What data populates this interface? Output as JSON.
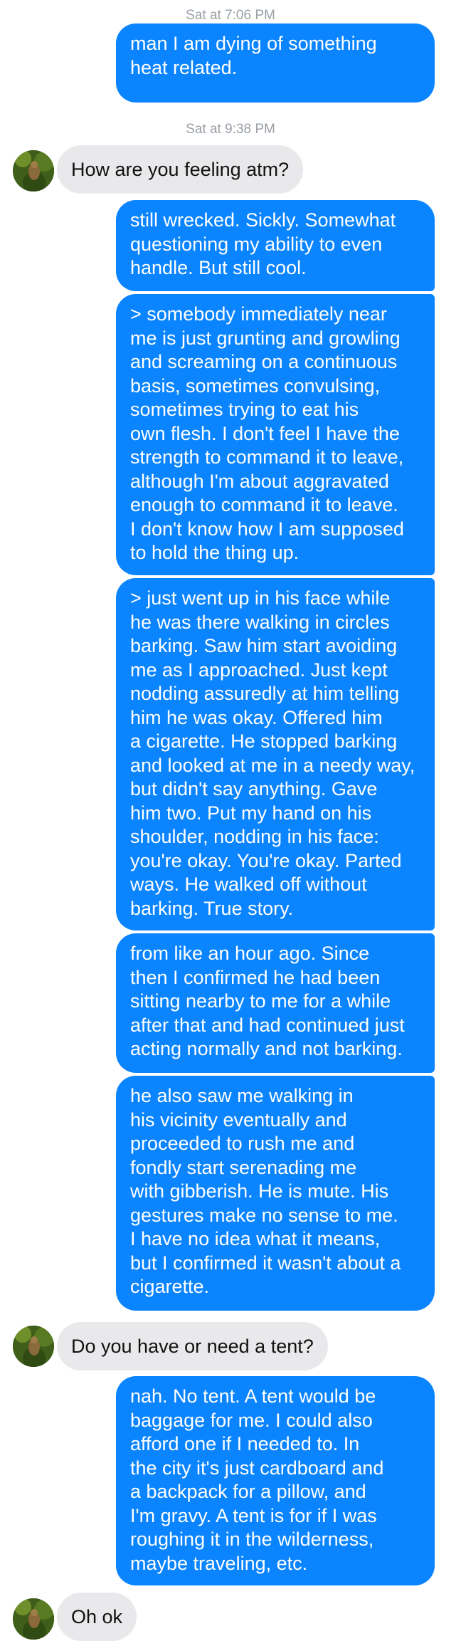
{
  "thread": {
    "timestamps": [
      "Sat at 7:06 PM",
      "Sat at 9:38 PM"
    ],
    "messages": [
      {
        "from": "me",
        "lines": [
          "man I am dying of something",
          "heat related."
        ]
      },
      {
        "from": "them",
        "lines": [
          "How are you feeling atm?"
        ]
      },
      {
        "from": "me",
        "lines": [
          "still wrecked. Sickly. Somewhat",
          "questioning my ability to even",
          "handle. But still cool."
        ]
      },
      {
        "from": "me",
        "lines": [
          "> somebody immediately near",
          "me is just grunting and growling",
          "and screaming on a continuous",
          "basis, sometimes convulsing,",
          "sometimes trying to eat his",
          "own flesh. I don't feel I have the",
          "strength to command it to leave,",
          "although I'm about aggravated",
          "enough to command it to leave.",
          "I don't know how I am supposed",
          "to hold the thing up."
        ]
      },
      {
        "from": "me",
        "lines": [
          "> just went up in his face while",
          "he was there walking in circles",
          "barking. Saw him start avoiding",
          "me as I approached. Just kept",
          "nodding assuredly at him telling",
          "him he was okay. Offered him",
          "a cigarette. He stopped barking",
          "and looked at me in a needy way,",
          "but didn't say anything. Gave",
          "him two. Put my hand on his",
          "shoulder, nodding in his face:",
          "you're okay. You're okay. Parted",
          "ways. He walked off without",
          "barking. True story."
        ]
      },
      {
        "from": "me",
        "lines": [
          "from like an hour ago. Since",
          "then I confirmed he had been",
          "sitting nearby to me for a while",
          "after that and had continued just",
          "acting normally and not barking."
        ]
      },
      {
        "from": "me",
        "lines": [
          "he also saw me walking in",
          "his vicinity eventually and",
          "proceeded to rush me and",
          "fondly start serenading me",
          "with gibberish. He is mute. His",
          "gestures make no sense to me.",
          "I have no idea what it means,",
          "but I confirmed it wasn't about a",
          "cigarette."
        ]
      },
      {
        "from": "them",
        "lines": [
          "Do you have or need a tent?"
        ]
      },
      {
        "from": "me",
        "lines": [
          "nah. No tent. A tent would be",
          "baggage for me. I could also",
          "afford one if I needed to. In",
          "the city it's just cardboard and",
          "a backpack for a pillow, and",
          "I'm gravy. A tent is for if I was",
          "roughing it in the wilderness,",
          "maybe traveling, etc."
        ]
      },
      {
        "from": "them",
        "lines": [
          "Oh ok"
        ]
      }
    ]
  },
  "colors": {
    "outgoing_bubble": "#0a84ff",
    "incoming_bubble": "#e9e9eb",
    "timestamp_text": "#9aa0a6"
  },
  "icons": {
    "contact_avatar": "contact-avatar-photo"
  }
}
